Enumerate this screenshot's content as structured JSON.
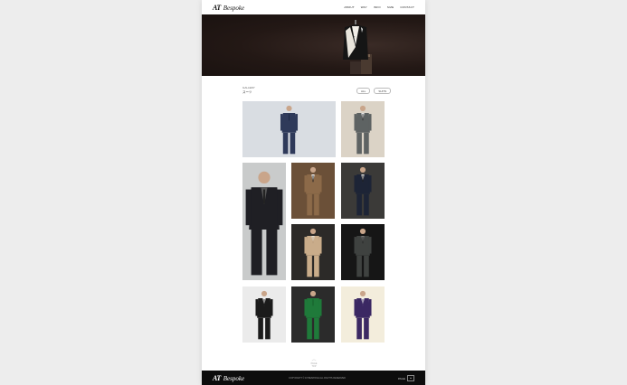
{
  "brand": {
    "mark": "AT",
    "name": "Bespoke"
  },
  "nav": {
    "items": [
      "ABOUT",
      "WAY",
      "INFO",
      "SIZE",
      "CONTACT"
    ]
  },
  "breadcrumb": {
    "top": "GALLERY",
    "title": "スーツ"
  },
  "filters": {
    "items": [
      "ALL",
      "SUITS"
    ]
  },
  "gallery": {
    "items": [
      {
        "name": "gallery-photo-navy-double-breasted",
        "bg": "#d9dde2",
        "suit": "#2f3a5a",
        "shirt": "#2f3a5a",
        "tie": "#1f2842"
      },
      {
        "name": "gallery-photo-grey-suit",
        "bg": "#dbd3c6",
        "suit": "#5e6363",
        "shirt": "#e9e9e9",
        "tie": "#2a2a2a"
      },
      {
        "name": "gallery-photo-black-suit-tall",
        "bg": "#c9cbcb",
        "suit": "#1f1f24",
        "shirt": "#555",
        "tie": "#222"
      },
      {
        "name": "gallery-photo-camel-suit-detail",
        "bg": "#6b5038",
        "suit": "#8c6a49",
        "shirt": "#f2f2f2",
        "tie": "#111"
      },
      {
        "name": "gallery-photo-runway-navy",
        "bg": "#3b3a38",
        "suit": "#1d2436",
        "shirt": "#ddd",
        "tie": "#111"
      },
      {
        "name": "gallery-photo-beige-suit-runway",
        "bg": "#2c2a28",
        "suit": "#c9ac8a",
        "shirt": "#e8e0d3",
        "tie": "#b89a78"
      },
      {
        "name": "gallery-photo-charcoal-suit-dark",
        "bg": "#161616",
        "suit": "#3f4240",
        "shirt": "#777",
        "tie": "#222"
      },
      {
        "name": "gallery-photo-black-suit-white-bg",
        "bg": "#ebebeb",
        "suit": "#1b1b1b",
        "shirt": "#eee",
        "tie": "#111"
      },
      {
        "name": "gallery-photo-green-suit",
        "bg": "#2b2b2b",
        "suit": "#1f7a3a",
        "shirt": "#1f7a3a",
        "tie": "#155c2a"
      },
      {
        "name": "gallery-photo-purple-suit",
        "bg": "#f3eddc",
        "suit": "#3b2863",
        "shirt": "#f0f0f0",
        "tie": "#3b2863"
      }
    ]
  },
  "hero": {
    "bg": "#231815"
  },
  "totop": {
    "arrow": "︿",
    "label": "PAGE TOP"
  },
  "footer": {
    "copyright": "COPYRIGHT © AT BESPOKE ALL RIGHTS RESERVED",
    "lang_label": "PAGE",
    "lang_box": "▲"
  }
}
